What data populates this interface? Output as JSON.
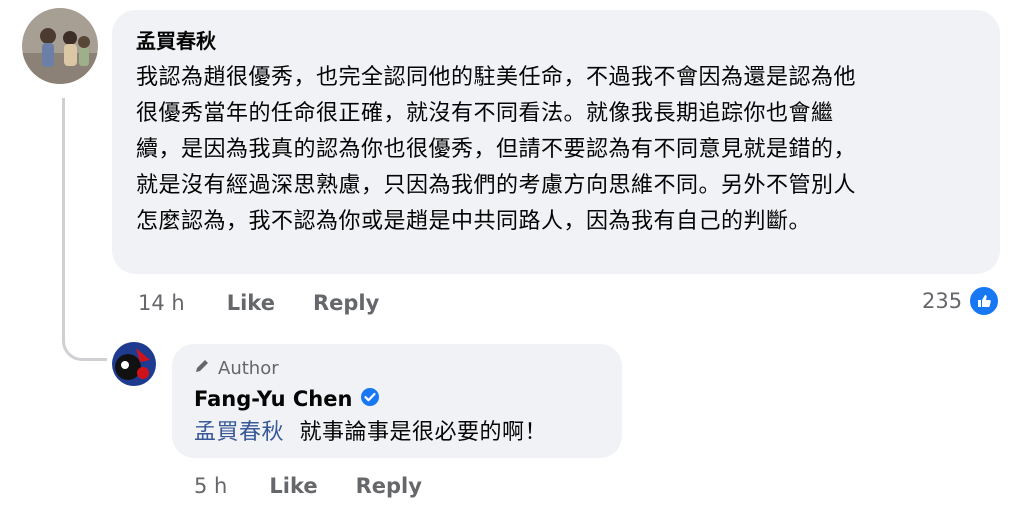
{
  "comment": {
    "author": "孟買春秋",
    "lines": [
      "我認為趙很優秀，也完全認同他的駐美任命，不過我不會因為還是認為他",
      "很優秀當年的任命很正確，就沒有不同看法。就像我長期追踪你也會繼",
      "續，是因為我真的認為你也很優秀，但請不要認為有不同意見就是錯的，",
      "就是沒有經過深思熟慮，只因為我們的考慮方向思維不同。另外不管別人",
      "怎麼認為，我不認為你或是趙是中共同路人，因為我有自己的判斷。"
    ],
    "time": "14 h",
    "like_label": "Like",
    "reply_label": "Reply",
    "reaction_count": "235"
  },
  "reply": {
    "badge": "Author",
    "author": "Fang-Yu Chen",
    "mention": "孟買春秋",
    "text": "就事論事是很必要的啊！",
    "time": "5 h",
    "like_label": "Like",
    "reply_label": "Reply"
  },
  "colors": {
    "bubble": "#f0f2f5",
    "meta": "#65676b",
    "link": "#385898",
    "accent": "#1877f2"
  }
}
